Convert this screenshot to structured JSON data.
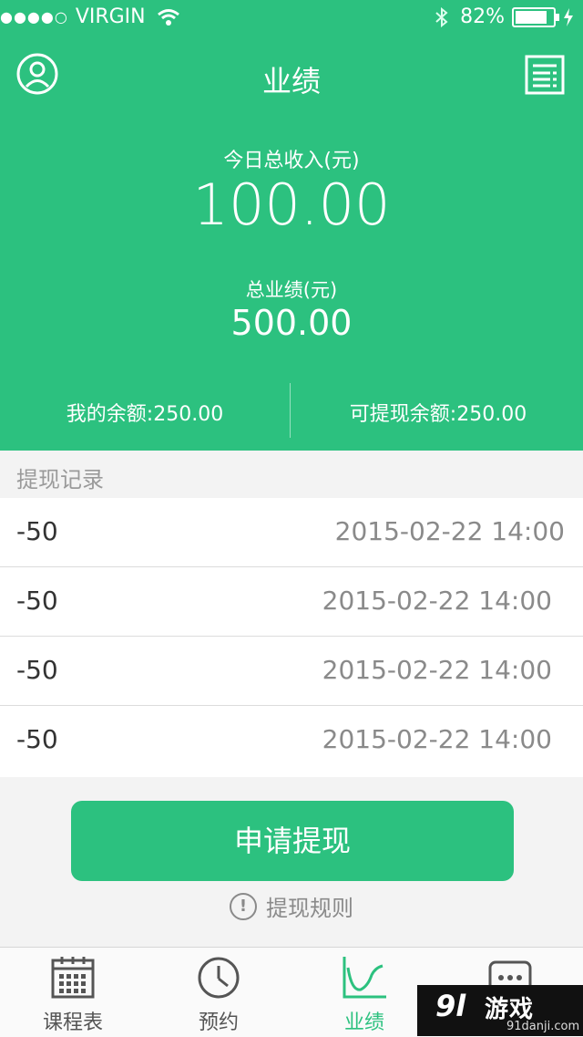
{
  "status_bar": {
    "carrier": "VIRGIN",
    "battery_percent": "82%"
  },
  "nav": {
    "title": "业绩"
  },
  "summary": {
    "today_income_label": "今日总收入(元)",
    "today_income_value": "100.00",
    "total_performance_label": "总业绩(元)",
    "total_performance_value": "500.00",
    "my_balance": "我的余额:250.00",
    "withdrawable_balance": "可提现余额:250.00"
  },
  "records": {
    "title": "提现记录",
    "rows": [
      {
        "amount": "-50",
        "time": "2015-02-22 14:00"
      },
      {
        "amount": "-50",
        "time": "2015-02-22 14:00"
      },
      {
        "amount": "-50",
        "time": "2015-02-22 14:00"
      },
      {
        "amount": "-50",
        "time": "2015-02-22 14:00"
      }
    ]
  },
  "actions": {
    "apply_withdraw_label": "申请提现",
    "rules_label": "提现规则"
  },
  "tabbar": {
    "items": [
      {
        "label": "课程表",
        "icon": "calendar-icon"
      },
      {
        "label": "预约",
        "icon": "clock-icon"
      },
      {
        "label": "业绩",
        "icon": "chart-icon",
        "active": true
      },
      {
        "label": "",
        "icon": "more-icon"
      }
    ]
  },
  "watermark": {
    "brand": "游戏",
    "domain": "91danji.com",
    "logo": "9l"
  },
  "colors": {
    "accent": "#2cc17f",
    "background": "#f3f3f3"
  }
}
